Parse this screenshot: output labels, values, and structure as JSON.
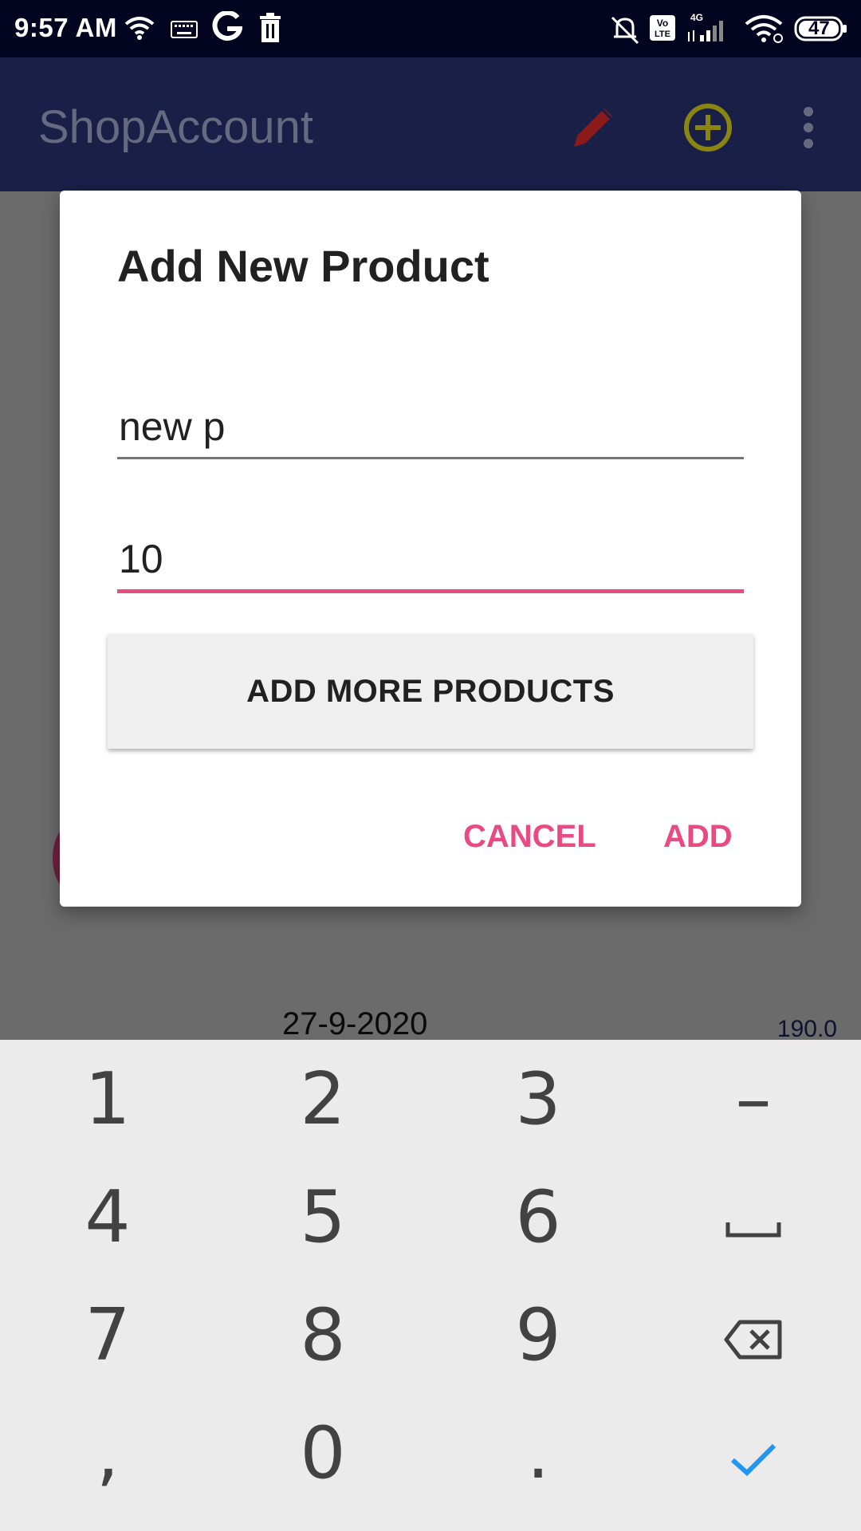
{
  "status_bar": {
    "time": "9:57 AM",
    "battery": "47",
    "network": "4G",
    "volte": "Vo LTE"
  },
  "app_bar": {
    "title": "ShopAccount",
    "edit_icon_color": "#8b1a1a",
    "add_icon_color": "#8a8510"
  },
  "background": {
    "date": "27-9-2020",
    "amount": "190.0"
  },
  "dialog": {
    "title": "Add New Product",
    "product_name_value": "new p",
    "quantity_value": "10",
    "add_more_label": "ADD MORE PRODUCTS",
    "cancel_label": "CANCEL",
    "add_label": "ADD",
    "accent_color": "#e94a82"
  },
  "keyboard": {
    "keys": [
      "1",
      "2",
      "3",
      "–",
      "4",
      "5",
      "6",
      "space",
      "7",
      "8",
      "9",
      "backspace",
      ",",
      "0",
      ".",
      "done"
    ],
    "done_color": "#2196f3"
  }
}
